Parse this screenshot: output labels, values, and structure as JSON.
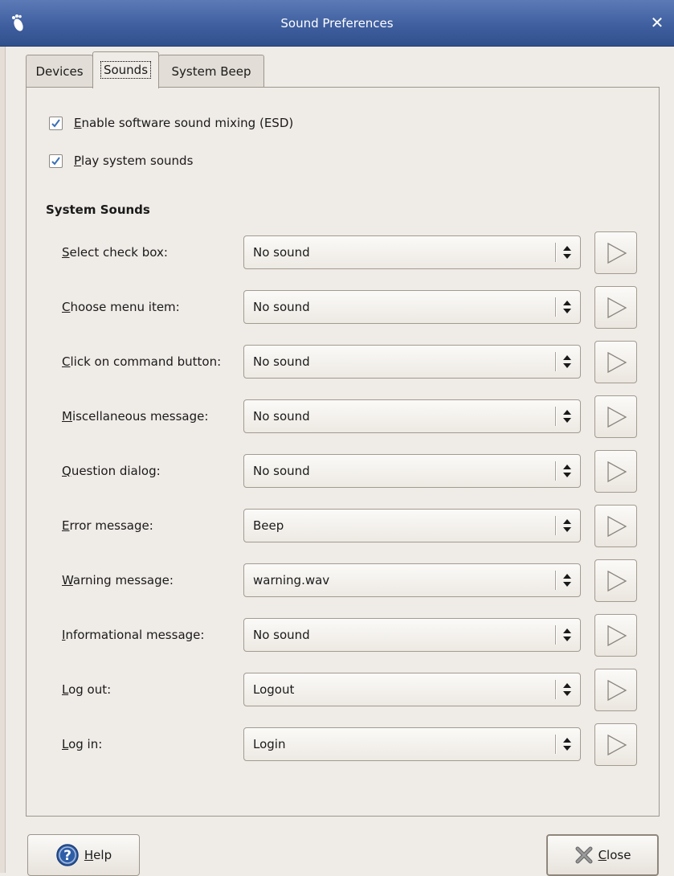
{
  "window": {
    "title": "Sound Preferences",
    "close_glyph": "✕",
    "icon": "gnome-foot-icon"
  },
  "tabs": [
    {
      "label": "Devices",
      "active": false
    },
    {
      "label": "Sounds",
      "active": true
    },
    {
      "label": "System Beep",
      "active": false
    }
  ],
  "options": {
    "enable_mixing": {
      "label_mnemonic": "E",
      "label_rest": "nable software sound mixing (ESD)",
      "checked": true
    },
    "play_sounds": {
      "label_mnemonic": "P",
      "label_rest": "lay system sounds",
      "checked": true
    }
  },
  "section_title": "System Sounds",
  "sounds": [
    {
      "label_mnemonic": "S",
      "label_rest": "elect check box:",
      "value": "No sound"
    },
    {
      "label_mnemonic": "C",
      "label_rest": "hoose menu item:",
      "value": "No sound"
    },
    {
      "label_mnemonic": "C",
      "label_rest": "lick on command button:",
      "value": "No sound"
    },
    {
      "label_mnemonic": "M",
      "label_rest": "iscellaneous message:",
      "value": "No sound"
    },
    {
      "label_mnemonic": "Q",
      "label_rest": "uestion dialog:",
      "value": "No sound"
    },
    {
      "label_mnemonic": "E",
      "label_rest": "rror message:",
      "value": "Beep"
    },
    {
      "label_mnemonic": "W",
      "label_rest": "arning message:",
      "value": "warning.wav"
    },
    {
      "label_mnemonic": "I",
      "label_rest": "nformational message:",
      "value": "No sound"
    },
    {
      "label_mnemonic": "L",
      "label_rest": "og out:",
      "value": "Logout"
    },
    {
      "label_mnemonic": "L",
      "label_rest": "og in:",
      "value": "Login"
    }
  ],
  "buttons": {
    "help": {
      "label_mnemonic": "H",
      "label_rest": "elp",
      "icon": "help-icon"
    },
    "close": {
      "label_mnemonic": "C",
      "label_rest": "lose",
      "icon": "close-icon"
    }
  },
  "colors": {
    "titlebar": "#3f5f9f",
    "check_accent": "#3a6fb8",
    "help_icon": "#2f5ea8"
  }
}
